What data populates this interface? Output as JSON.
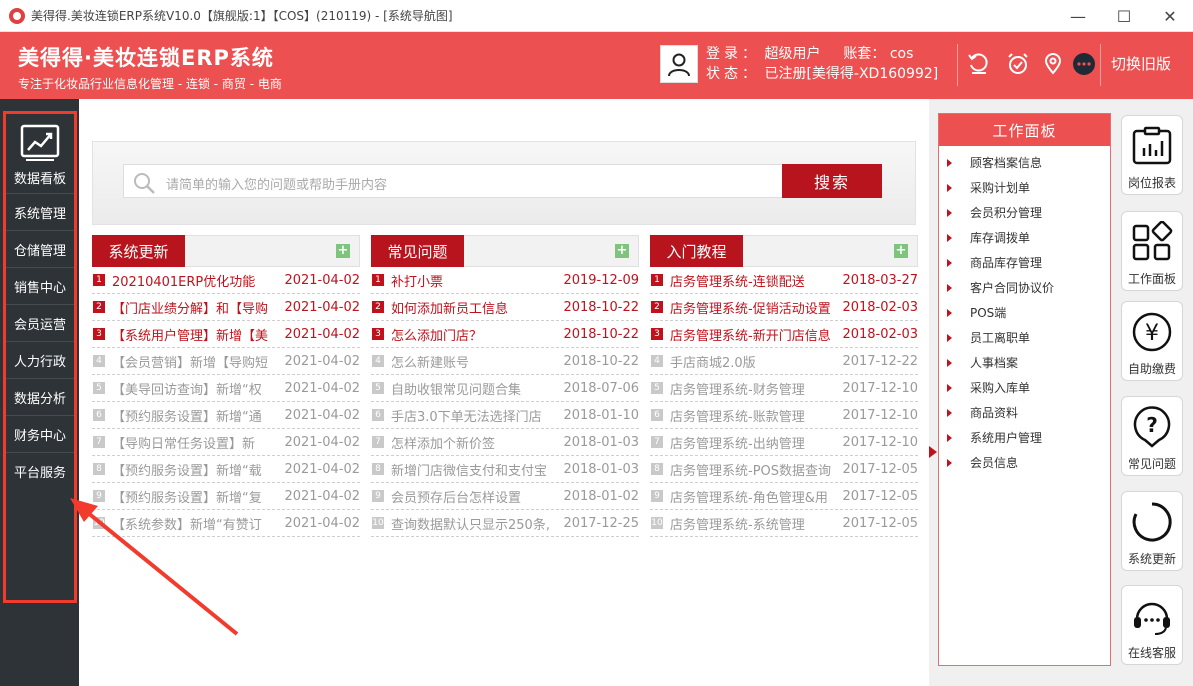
{
  "window": {
    "title": "美得得.美妆连锁ERP系统V10.0【旗舰版:1】【COS】(210119) - [系统导航图]",
    "minimize": "—",
    "maximize": "☐",
    "close": "✕"
  },
  "header": {
    "brand_name": "美得得·美妆连锁ERP系统",
    "slogan": "专注于化妆品行业信息化管理 - 连锁 - 商贸 - 电商",
    "login_label": "登录：",
    "login_user": "超级用户",
    "account_label": "账套：",
    "account_value": "cos",
    "status_label": "状态：",
    "status_value": "已注册[美得得-XD160992]",
    "switch_old": "切换旧版",
    "icons": [
      "refresh-icon",
      "alarm-icon",
      "location-icon",
      "chat-icon"
    ]
  },
  "sidebar": {
    "top_label": "数据看板",
    "items": [
      {
        "label": "系统管理"
      },
      {
        "label": "仓储管理"
      },
      {
        "label": "销售中心"
      },
      {
        "label": "会员运营"
      },
      {
        "label": "人力行政"
      },
      {
        "label": "数据分析"
      },
      {
        "label": "财务中心"
      },
      {
        "label": "平台服务"
      }
    ]
  },
  "search": {
    "placeholder": "请简单的输入您的问题或帮助手册内容",
    "button": "搜索"
  },
  "columns": [
    {
      "title": "系统更新",
      "plus": "+",
      "items": [
        {
          "num": "1",
          "text": "20210401ERP优化功能",
          "date": "2021-04-02",
          "hot": true
        },
        {
          "num": "2",
          "text": "【门店业绩分解】和【导购",
          "date": "2021-04-02",
          "hot": true
        },
        {
          "num": "3",
          "text": "【系统用户管理】新增【美",
          "date": "2021-04-02",
          "hot": true
        },
        {
          "num": "4",
          "text": "【会员营销】新增【导购短",
          "date": "2021-04-02",
          "hot": false
        },
        {
          "num": "5",
          "text": "【美导回访查询】新增“权",
          "date": "2021-04-02",
          "hot": false
        },
        {
          "num": "6",
          "text": "【预约服务设置】新增“通",
          "date": "2021-04-02",
          "hot": false
        },
        {
          "num": "7",
          "text": "【导购日常任务设置】新",
          "date": "2021-04-02",
          "hot": false
        },
        {
          "num": "8",
          "text": "【预约服务设置】新增“载",
          "date": "2021-04-02",
          "hot": false
        },
        {
          "num": "9",
          "text": "【预约服务设置】新增“复",
          "date": "2021-04-02",
          "hot": false
        },
        {
          "num": "10",
          "text": "【系统参数】新增“有赞订",
          "date": "2021-04-02",
          "hot": false
        }
      ]
    },
    {
      "title": "常见问题",
      "plus": "+",
      "items": [
        {
          "num": "1",
          "text": "补打小票",
          "date": "2019-12-09",
          "hot": true
        },
        {
          "num": "2",
          "text": "如何添加新员工信息",
          "date": "2018-10-22",
          "hot": true
        },
        {
          "num": "3",
          "text": "怎么添加门店？",
          "date": "2018-10-22",
          "hot": true
        },
        {
          "num": "4",
          "text": "怎么新建账号",
          "date": "2018-10-22",
          "hot": false
        },
        {
          "num": "5",
          "text": "自助收银常见问题合集",
          "date": "2018-07-06",
          "hot": false
        },
        {
          "num": "6",
          "text": "手店3.0下单无法选择门店",
          "date": "2018-01-10",
          "hot": false
        },
        {
          "num": "7",
          "text": "怎样添加个新价签",
          "date": "2018-01-03",
          "hot": false
        },
        {
          "num": "8",
          "text": "新增门店微信支付和支付宝",
          "date": "2018-01-03",
          "hot": false
        },
        {
          "num": "9",
          "text": "会员预存后台怎样设置",
          "date": "2018-01-02",
          "hot": false
        },
        {
          "num": "10",
          "text": "查询数据默认只显示250条,",
          "date": "2017-12-25",
          "hot": false
        }
      ]
    },
    {
      "title": "入门教程",
      "plus": "+",
      "items": [
        {
          "num": "1",
          "text": "店务管理系统-连锁配送",
          "date": "2018-03-27",
          "hot": true
        },
        {
          "num": "2",
          "text": "店务管理系统-促销活动设置",
          "date": "2018-02-03",
          "hot": true
        },
        {
          "num": "3",
          "text": "店务管理系统-新开门店信息",
          "date": "2018-02-03",
          "hot": true
        },
        {
          "num": "4",
          "text": "手店商城2.0版",
          "date": "2017-12-22",
          "hot": false
        },
        {
          "num": "5",
          "text": "店务管理系统-财务管理",
          "date": "2017-12-10",
          "hot": false
        },
        {
          "num": "6",
          "text": "店务管理系统-账款管理",
          "date": "2017-12-10",
          "hot": false
        },
        {
          "num": "7",
          "text": "店务管理系统-出纳管理",
          "date": "2017-12-10",
          "hot": false
        },
        {
          "num": "8",
          "text": "店务管理系统-POS数据查询",
          "date": "2017-12-05",
          "hot": false
        },
        {
          "num": "9",
          "text": "店务管理系统-角色管理&用",
          "date": "2017-12-05",
          "hot": false
        },
        {
          "num": "10",
          "text": "店务管理系统-系统管理",
          "date": "2017-12-05",
          "hot": false
        }
      ]
    }
  ],
  "work_panel": {
    "title": "工作面板",
    "items": [
      "顾客档案信息",
      "采购计划单",
      "会员积分管理",
      "库存调拨单",
      "商品库存管理",
      "客户合同协议价",
      "POS端",
      "员工离职单",
      "人事档案",
      "采购入库单",
      "商品资料",
      "系统用户管理",
      "会员信息"
    ]
  },
  "quick_links": [
    {
      "label": "岗位报表",
      "icon": "report-icon"
    },
    {
      "label": "工作面板",
      "icon": "workspace-icon"
    },
    {
      "label": "自助缴费",
      "icon": "yen-icon"
    },
    {
      "label": "常见问题",
      "icon": "question-icon"
    },
    {
      "label": "系统更新",
      "icon": "update-icon"
    },
    {
      "label": "在线客服",
      "icon": "headset-icon"
    }
  ],
  "colors": {
    "header_red": "#ec5050",
    "dark_red": "#b8141e",
    "sidebar_dark": "#2e3337",
    "annotation_red": "#f23a2d"
  }
}
